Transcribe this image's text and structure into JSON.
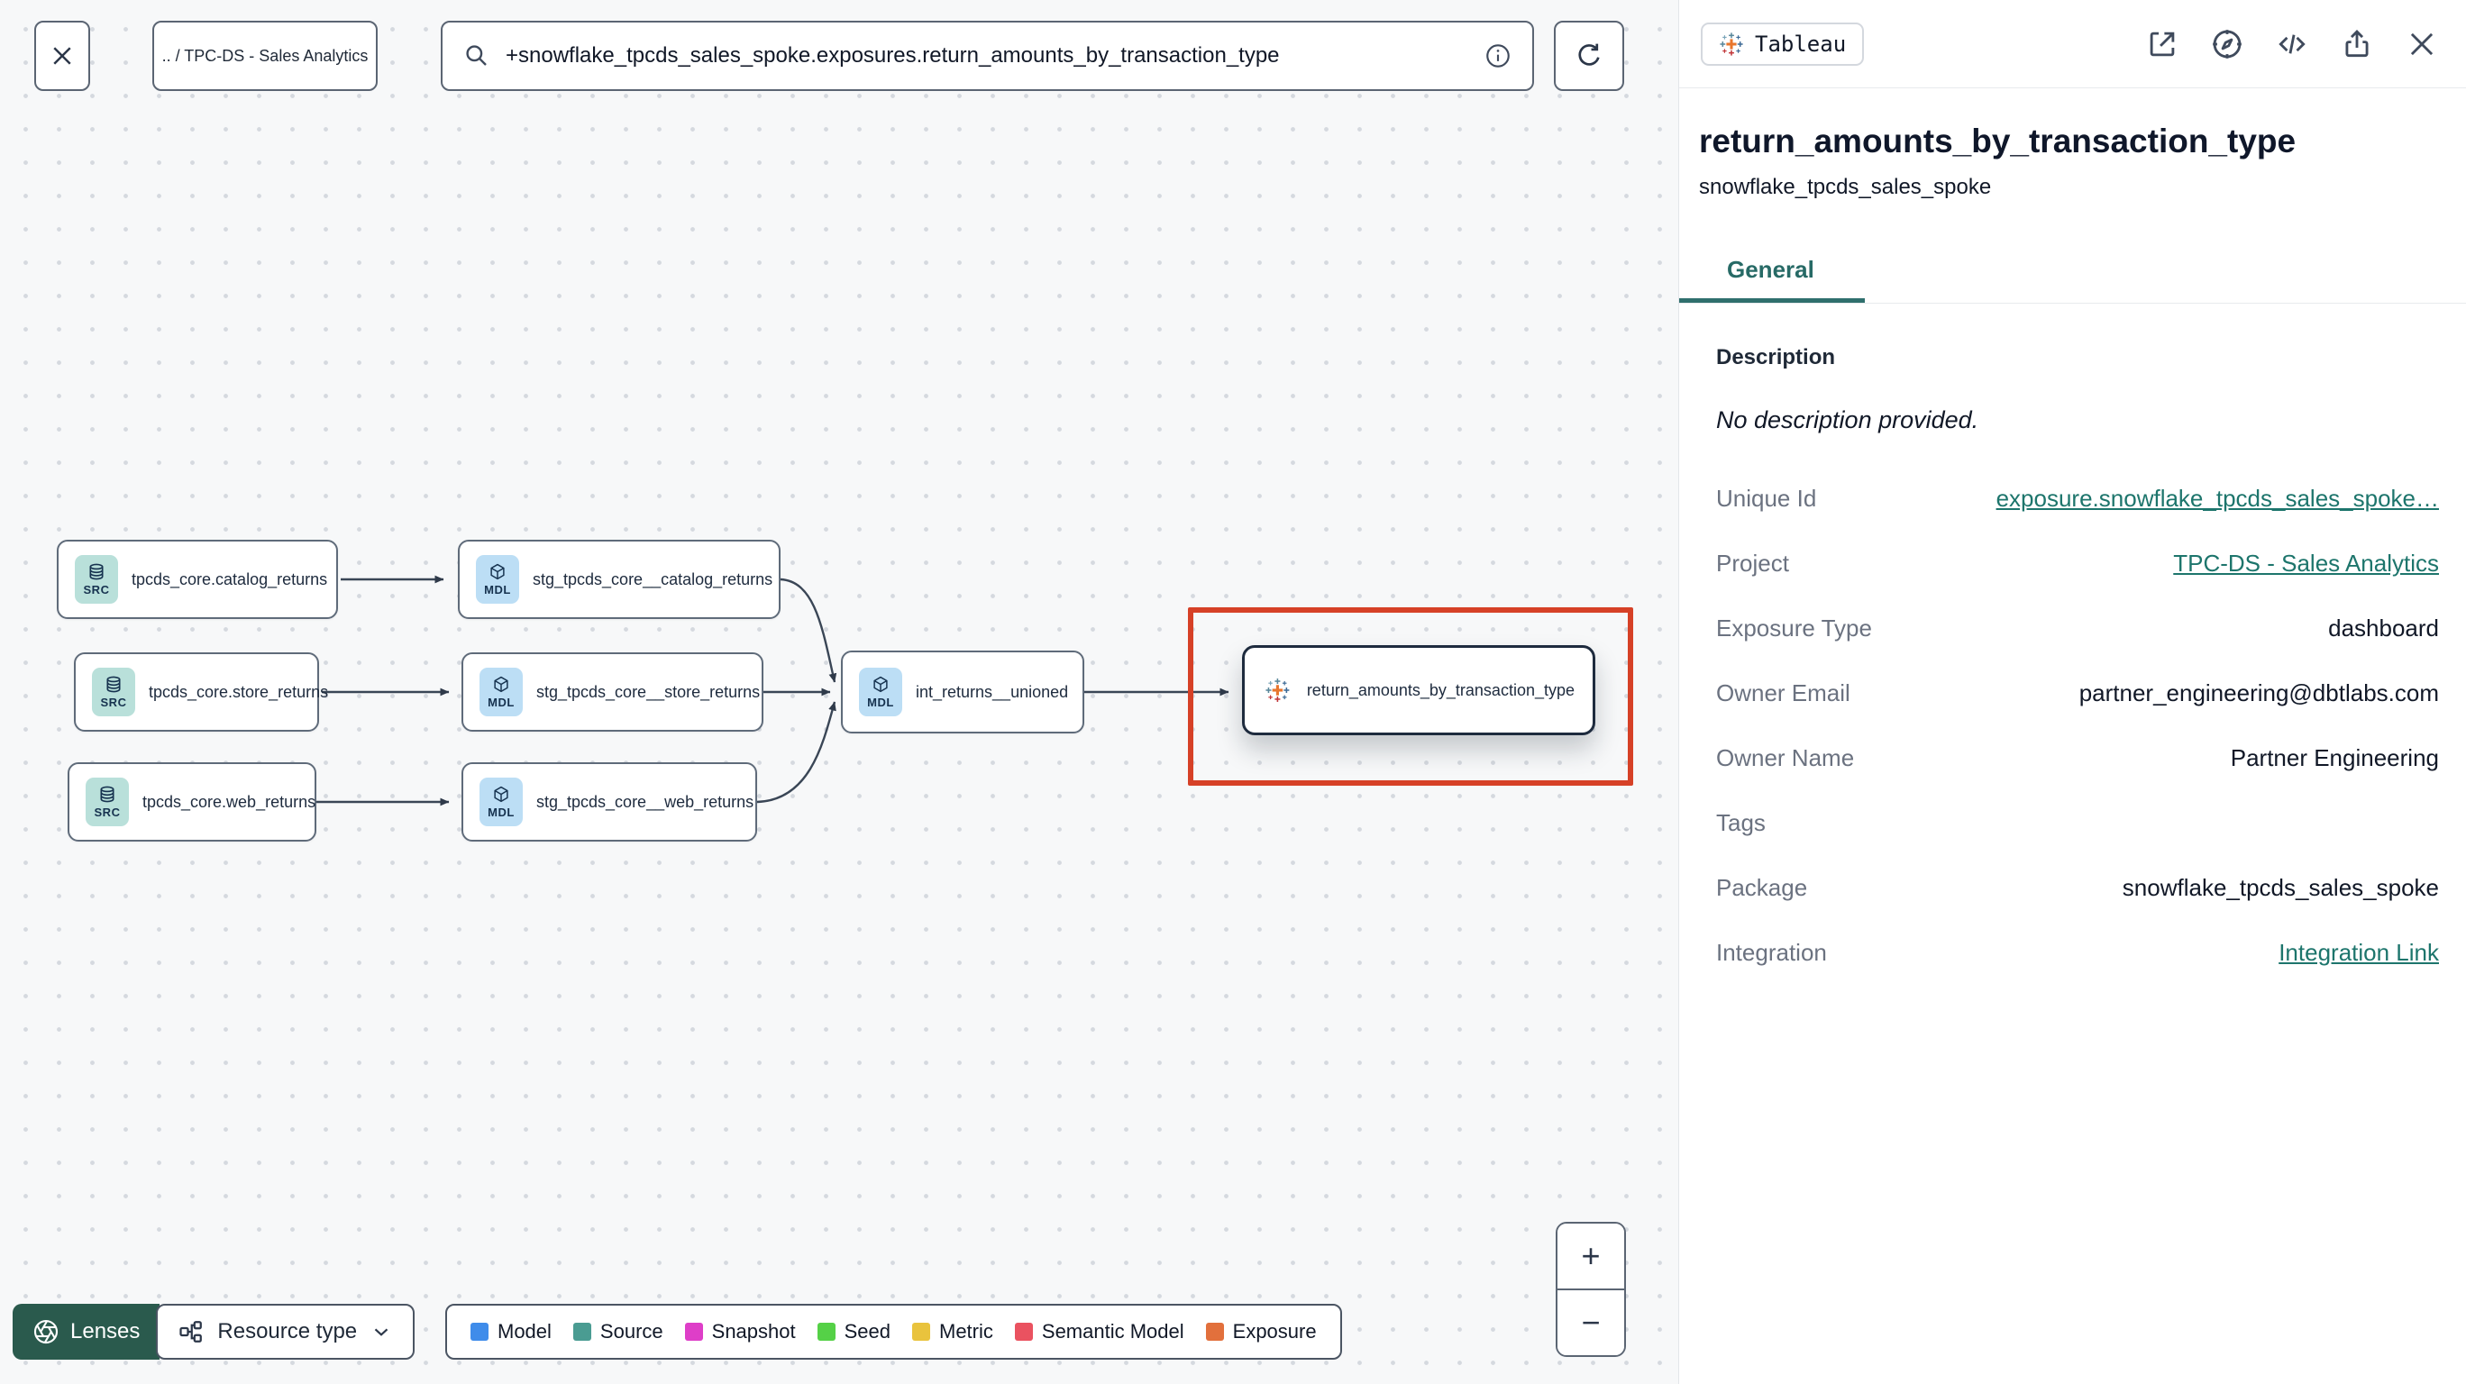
{
  "topbar": {
    "breadcrumb": ".. / TPC-DS - Sales Analytics",
    "search_value": "+snowflake_tpcds_sales_spoke.exposures.return_amounts_by_transaction_type"
  },
  "graph": {
    "nodes": [
      {
        "badge": "SRC",
        "label": "tpcds_core.catalog_returns"
      },
      {
        "badge": "SRC",
        "label": "tpcds_core.store_returns"
      },
      {
        "badge": "SRC",
        "label": "tpcds_core.web_returns"
      },
      {
        "badge": "MDL",
        "label": "stg_tpcds_core__catalog_returns"
      },
      {
        "badge": "MDL",
        "label": "stg_tpcds_core__store_returns"
      },
      {
        "badge": "MDL",
        "label": "stg_tpcds_core__web_returns"
      },
      {
        "badge": "MDL",
        "label": "int_returns__unioned"
      },
      {
        "badge": "Tableau",
        "label": "return_amounts_by_transaction_type"
      }
    ]
  },
  "controls": {
    "lenses_label": "Lenses",
    "resource_type_label": "Resource type",
    "zoom_in": "+",
    "zoom_out": "−"
  },
  "legend": {
    "items": [
      {
        "label": "Model",
        "color": "#3f8cea"
      },
      {
        "label": "Source",
        "color": "#4a9c92"
      },
      {
        "label": "Snapshot",
        "color": "#de3ec8"
      },
      {
        "label": "Seed",
        "color": "#55d147"
      },
      {
        "label": "Metric",
        "color": "#e9c33d"
      },
      {
        "label": "Semantic Model",
        "color": "#ea5260"
      },
      {
        "label": "Exposure",
        "color": "#e2703c"
      }
    ]
  },
  "panel": {
    "badge_label": "Tableau",
    "title": "return_amounts_by_transaction_type",
    "subtitle": "snowflake_tpcds_sales_spoke",
    "tab_label": "General",
    "description_label": "Description",
    "description_value": "No description provided.",
    "fields": [
      {
        "label": "Unique Id",
        "value": "exposure.snowflake_tpcds_sales_spoke…",
        "link": true
      },
      {
        "label": "Project",
        "value": "TPC-DS - Sales Analytics",
        "link": true
      },
      {
        "label": "Exposure Type",
        "value": "dashboard"
      },
      {
        "label": "Owner Email",
        "value": "partner_engineering@dbtlabs.com"
      },
      {
        "label": "Owner Name",
        "value": "Partner Engineering"
      },
      {
        "label": "Tags",
        "value": ""
      },
      {
        "label": "Package",
        "value": "snowflake_tpcds_sales_spoke"
      },
      {
        "label": "Integration",
        "value": "Integration Link",
        "link": true
      }
    ]
  },
  "colors": {
    "accent_teal": "#1d756c",
    "selection_red": "#d64127",
    "lenses_green": "#2a5a4d",
    "src_tile": "#b9e0da",
    "mdl_tile": "#bcdef5"
  }
}
